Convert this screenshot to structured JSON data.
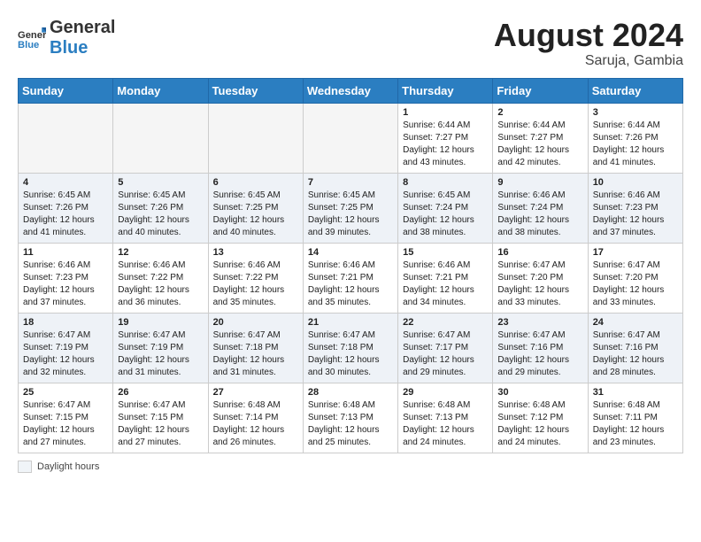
{
  "header": {
    "logo_general": "General",
    "logo_blue": "Blue",
    "month_year": "August 2024",
    "location": "Saruja, Gambia"
  },
  "weekdays": [
    "Sunday",
    "Monday",
    "Tuesday",
    "Wednesday",
    "Thursday",
    "Friday",
    "Saturday"
  ],
  "weeks": [
    [
      {
        "day": "",
        "info": ""
      },
      {
        "day": "",
        "info": ""
      },
      {
        "day": "",
        "info": ""
      },
      {
        "day": "",
        "info": ""
      },
      {
        "day": "1",
        "info": "Sunrise: 6:44 AM\nSunset: 7:27 PM\nDaylight: 12 hours and 43 minutes."
      },
      {
        "day": "2",
        "info": "Sunrise: 6:44 AM\nSunset: 7:27 PM\nDaylight: 12 hours and 42 minutes."
      },
      {
        "day": "3",
        "info": "Sunrise: 6:44 AM\nSunset: 7:26 PM\nDaylight: 12 hours and 41 minutes."
      }
    ],
    [
      {
        "day": "4",
        "info": "Sunrise: 6:45 AM\nSunset: 7:26 PM\nDaylight: 12 hours and 41 minutes."
      },
      {
        "day": "5",
        "info": "Sunrise: 6:45 AM\nSunset: 7:26 PM\nDaylight: 12 hours and 40 minutes."
      },
      {
        "day": "6",
        "info": "Sunrise: 6:45 AM\nSunset: 7:25 PM\nDaylight: 12 hours and 40 minutes."
      },
      {
        "day": "7",
        "info": "Sunrise: 6:45 AM\nSunset: 7:25 PM\nDaylight: 12 hours and 39 minutes."
      },
      {
        "day": "8",
        "info": "Sunrise: 6:45 AM\nSunset: 7:24 PM\nDaylight: 12 hours and 38 minutes."
      },
      {
        "day": "9",
        "info": "Sunrise: 6:46 AM\nSunset: 7:24 PM\nDaylight: 12 hours and 38 minutes."
      },
      {
        "day": "10",
        "info": "Sunrise: 6:46 AM\nSunset: 7:23 PM\nDaylight: 12 hours and 37 minutes."
      }
    ],
    [
      {
        "day": "11",
        "info": "Sunrise: 6:46 AM\nSunset: 7:23 PM\nDaylight: 12 hours and 37 minutes."
      },
      {
        "day": "12",
        "info": "Sunrise: 6:46 AM\nSunset: 7:22 PM\nDaylight: 12 hours and 36 minutes."
      },
      {
        "day": "13",
        "info": "Sunrise: 6:46 AM\nSunset: 7:22 PM\nDaylight: 12 hours and 35 minutes."
      },
      {
        "day": "14",
        "info": "Sunrise: 6:46 AM\nSunset: 7:21 PM\nDaylight: 12 hours and 35 minutes."
      },
      {
        "day": "15",
        "info": "Sunrise: 6:46 AM\nSunset: 7:21 PM\nDaylight: 12 hours and 34 minutes."
      },
      {
        "day": "16",
        "info": "Sunrise: 6:47 AM\nSunset: 7:20 PM\nDaylight: 12 hours and 33 minutes."
      },
      {
        "day": "17",
        "info": "Sunrise: 6:47 AM\nSunset: 7:20 PM\nDaylight: 12 hours and 33 minutes."
      }
    ],
    [
      {
        "day": "18",
        "info": "Sunrise: 6:47 AM\nSunset: 7:19 PM\nDaylight: 12 hours and 32 minutes."
      },
      {
        "day": "19",
        "info": "Sunrise: 6:47 AM\nSunset: 7:19 PM\nDaylight: 12 hours and 31 minutes."
      },
      {
        "day": "20",
        "info": "Sunrise: 6:47 AM\nSunset: 7:18 PM\nDaylight: 12 hours and 31 minutes."
      },
      {
        "day": "21",
        "info": "Sunrise: 6:47 AM\nSunset: 7:18 PM\nDaylight: 12 hours and 30 minutes."
      },
      {
        "day": "22",
        "info": "Sunrise: 6:47 AM\nSunset: 7:17 PM\nDaylight: 12 hours and 29 minutes."
      },
      {
        "day": "23",
        "info": "Sunrise: 6:47 AM\nSunset: 7:16 PM\nDaylight: 12 hours and 29 minutes."
      },
      {
        "day": "24",
        "info": "Sunrise: 6:47 AM\nSunset: 7:16 PM\nDaylight: 12 hours and 28 minutes."
      }
    ],
    [
      {
        "day": "25",
        "info": "Sunrise: 6:47 AM\nSunset: 7:15 PM\nDaylight: 12 hours and 27 minutes."
      },
      {
        "day": "26",
        "info": "Sunrise: 6:47 AM\nSunset: 7:15 PM\nDaylight: 12 hours and 27 minutes."
      },
      {
        "day": "27",
        "info": "Sunrise: 6:48 AM\nSunset: 7:14 PM\nDaylight: 12 hours and 26 minutes."
      },
      {
        "day": "28",
        "info": "Sunrise: 6:48 AM\nSunset: 7:13 PM\nDaylight: 12 hours and 25 minutes."
      },
      {
        "day": "29",
        "info": "Sunrise: 6:48 AM\nSunset: 7:13 PM\nDaylight: 12 hours and 24 minutes."
      },
      {
        "day": "30",
        "info": "Sunrise: 6:48 AM\nSunset: 7:12 PM\nDaylight: 12 hours and 24 minutes."
      },
      {
        "day": "31",
        "info": "Sunrise: 6:48 AM\nSunset: 7:11 PM\nDaylight: 12 hours and 23 minutes."
      }
    ]
  ],
  "footer": {
    "legend_label": "Daylight hours"
  }
}
